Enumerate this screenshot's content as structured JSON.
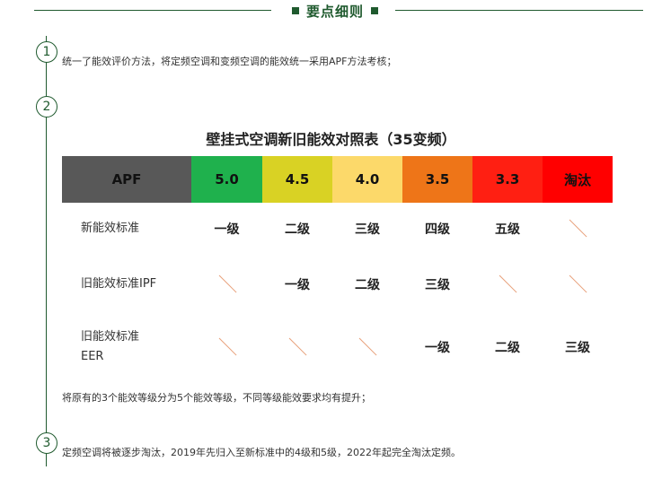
{
  "header": {
    "title": "要点细则"
  },
  "steps": [
    {
      "num": "1",
      "text": "统一了能效评价方法，将定频空调和变频空调的能效统一采用APF方法考核；"
    },
    {
      "num": "2",
      "text": "将原有的3个能效等级分为5个能效等级，不同等级能效要求均有提升；"
    },
    {
      "num": "3",
      "text": "定频空调将被逐步淘汰，2019年先归入至新标准中的4级和5级，2022年起完全淘汰定频。"
    }
  ],
  "table": {
    "title": "壁挂式空调新旧能效对照表（35变频）",
    "header_label": "APF",
    "columns": [
      {
        "label": "5.0",
        "bg": "#1fb14d",
        "color": "#111111"
      },
      {
        "label": "4.5",
        "bg": "#d9d224",
        "color": "#111111"
      },
      {
        "label": "4.0",
        "bg": "#fcd96a",
        "color": "#111111"
      },
      {
        "label": "3.5",
        "bg": "#ee7518",
        "color": "#111111"
      },
      {
        "label": "3.3",
        "bg": "#ff1f12",
        "color": "#111111"
      },
      {
        "label": "淘汰",
        "bg": "#ff0000",
        "color": "#111111"
      }
    ],
    "header_bg": "#585858",
    "rows": [
      {
        "label": "新能效标准",
        "values": [
          "一级",
          "二级",
          "三级",
          "四级",
          "五级",
          "/"
        ]
      },
      {
        "label": "旧能效标准IPF",
        "values": [
          "/",
          "一级",
          "二级",
          "三级",
          "/",
          "/"
        ]
      },
      {
        "label": "旧能效标准EER",
        "label_line1": "旧能效标准",
        "label_line2": "EER",
        "values": [
          "/",
          "/",
          "/",
          "一级",
          "二级",
          "三级"
        ]
      }
    ]
  }
}
